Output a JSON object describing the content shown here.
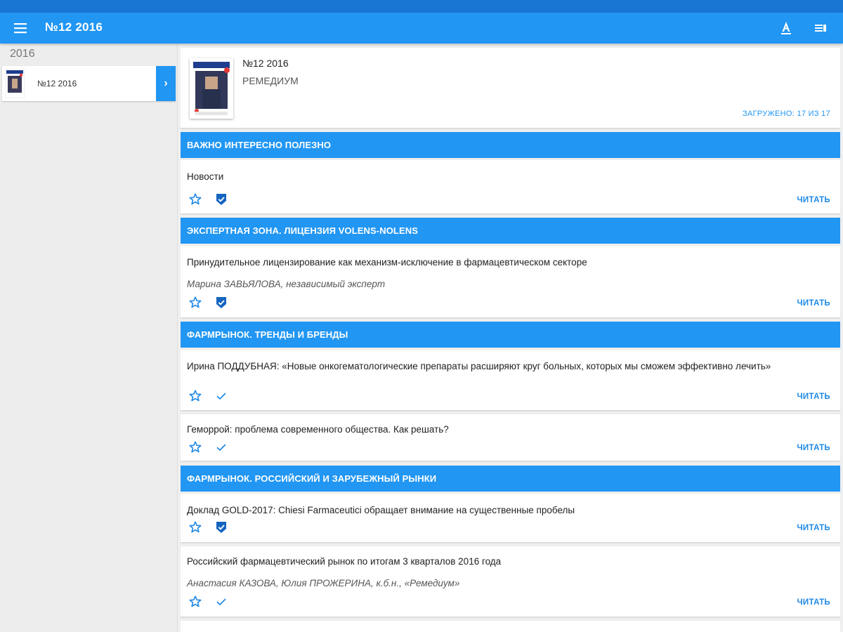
{
  "app": {
    "title": "№12 2016",
    "menu_icon": "hamburger-menu-icon",
    "actions": [
      "text-size-icon",
      "view-list-icon"
    ]
  },
  "sidebar": {
    "year": "2016",
    "issues": [
      {
        "label": "№12 2016"
      }
    ]
  },
  "issue_header": {
    "title": "№12 2016",
    "publication": "РЕМЕДИУМ",
    "loaded": "ЗАГРУЖЕНО: 17 ИЗ 17"
  },
  "sections": [
    {
      "title": "ВАЖНО ИНТЕРЕСНО ПОЛЕЗНО"
    },
    {
      "title": "ЭКСПЕРТНАЯ ЗОНА. ЛИЦЕНЗИЯ VOLENS-NOLENS"
    },
    {
      "title": "ФАРМРЫНОК. ТРЕНДЫ И БРЕНДЫ"
    },
    {
      "title": "ФАРМРЫНОК. РОССИЙСКИЙ И ЗАРУБЕЖНЫЙ РЫНКИ"
    }
  ],
  "articles": [
    {
      "title": "Новости",
      "author": "",
      "downloaded": true
    },
    {
      "title": "Принудительное лицензирование как механизм-исключение в фармацевтическом секторе",
      "author": "Марина ЗАВЬЯЛОВА, независимый эксперт",
      "downloaded": true
    },
    {
      "title": "Ирина ПОДДУБНАЯ: «Новые онкогематологические препараты расширяют круг больных, которых мы сможем эффективно лечить»",
      "author": "",
      "downloaded": false
    },
    {
      "title": "Геморрой: проблема современного общества. Как решать?",
      "author": "",
      "downloaded": false
    },
    {
      "title": "Доклад GOLD-2017: Chiesi Farmaceutici обращает внимание на существенные пробелы",
      "author": "",
      "downloaded": true
    },
    {
      "title": "Российский фармацевтический рынок по итогам 3 кварталов 2016 года",
      "author": "Анастасия КАЗОВА, Юлия ПРОЖЕРИНА, к.б.н., «Ремедиум»",
      "downloaded": false
    }
  ],
  "read_label": "ЧИТАТЬ",
  "colors": {
    "primary": "#2196f3",
    "status_bar": "#1976d2",
    "accent_dark": "#1565c0"
  }
}
